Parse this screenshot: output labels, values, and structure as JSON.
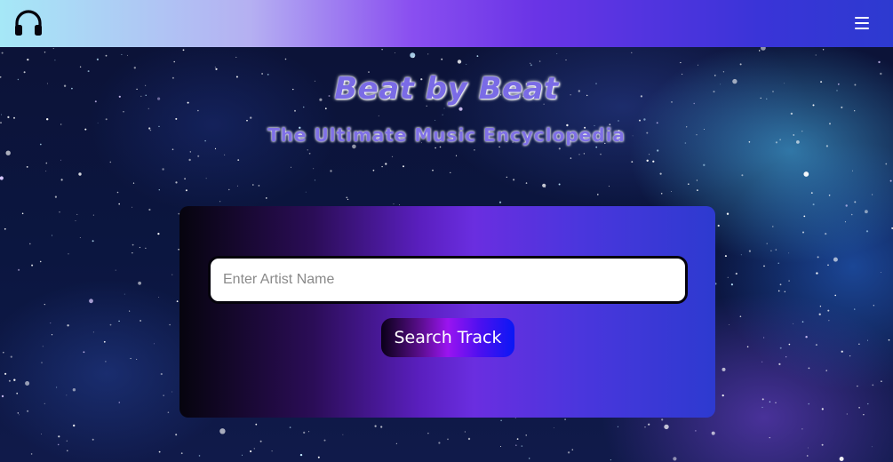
{
  "navbar": {
    "logo_icon": "headphones-icon",
    "menu_icon": "hamburger-menu-icon"
  },
  "hero": {
    "title": "Beat by Beat",
    "subtitle": "The Ultimate Music Encyclopedia"
  },
  "search": {
    "placeholder": "Enter Artist Name",
    "value": "",
    "button_label": "Search Track"
  },
  "colors": {
    "navbar_gradient": [
      "#a6e8f7",
      "#8a4ff0",
      "#2d3ad0"
    ],
    "panel_gradient": [
      "#06040e",
      "#6a2ee0",
      "#2d3ad0"
    ],
    "button_gradient": [
      "#0a0018",
      "#9a14f0",
      "#0a18f5"
    ]
  }
}
